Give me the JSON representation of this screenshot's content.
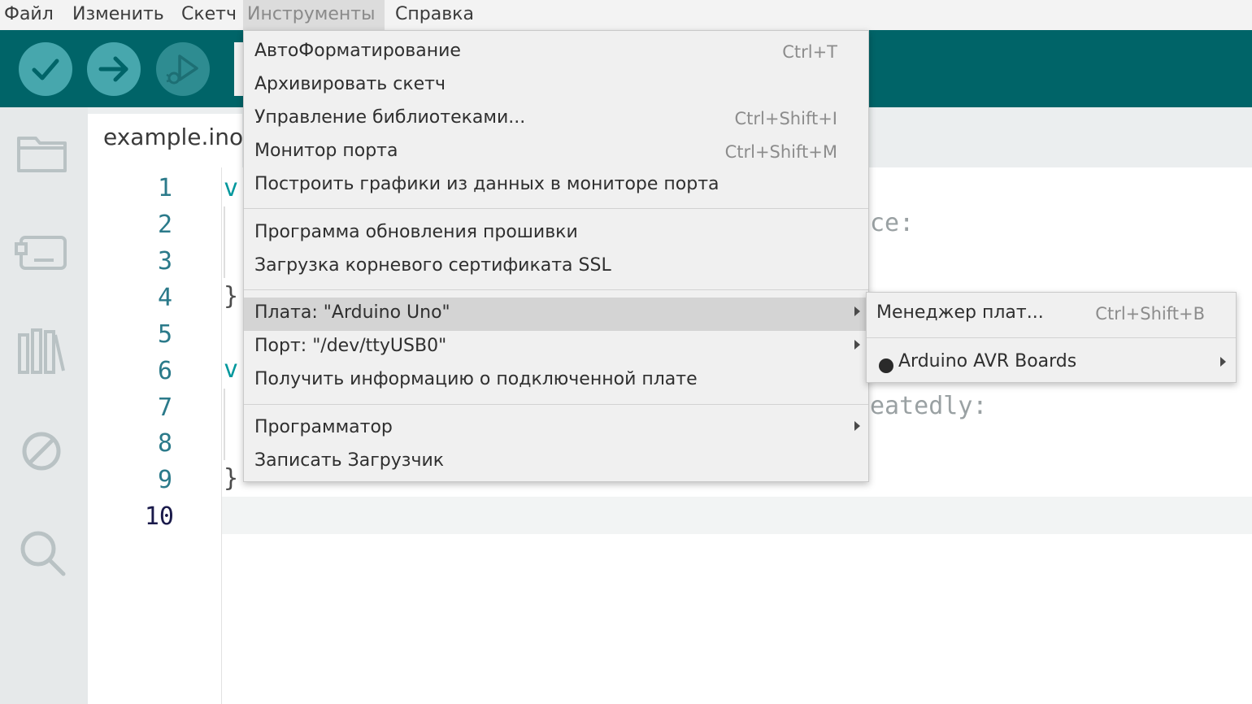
{
  "menubar": {
    "file": "Файл",
    "edit": "Изменить",
    "sketch": "Скетч",
    "tools": "Инструменты",
    "help": "Справка"
  },
  "toolbar": {
    "verify_icon": "check-icon",
    "upload_icon": "arrow-right-icon",
    "debug_icon": "debug-icon"
  },
  "sidebar": {
    "icons": [
      "folder-icon",
      "board-icon",
      "library-icon",
      "debug-off-icon",
      "search-icon"
    ]
  },
  "editor": {
    "tab_name": "example.ino",
    "line_numbers": [
      "1",
      "2",
      "3",
      "4",
      "5",
      "6",
      "7",
      "8",
      "9",
      "10"
    ],
    "current_line": "10",
    "visible_code": {
      "line1_fragment": "v",
      "line2_fragment": "ce:",
      "line4_fragment": "}",
      "line6_fragment": "v",
      "line7_fragment": "eatedly:",
      "line9_fragment": "}"
    }
  },
  "tools_menu": {
    "items": [
      {
        "label": "АвтоФорматирование",
        "shortcut": "Ctrl+T"
      },
      {
        "label": "Архивировать скетч",
        "shortcut": ""
      },
      {
        "label": "Управление библиотеками...",
        "shortcut": "Ctrl+Shift+I"
      },
      {
        "label": "Монитор порта",
        "shortcut": "Ctrl+Shift+M"
      },
      {
        "label": "Построить графики из данных в мониторе порта",
        "shortcut": ""
      },
      {
        "label": "Программа обновления прошивки",
        "shortcut": ""
      },
      {
        "label": "Загрузка корневого сертификата SSL",
        "shortcut": ""
      },
      {
        "label": "Плата: \"Arduino Uno\"",
        "shortcut": "",
        "submenu": true,
        "highlighted": true
      },
      {
        "label": "Порт: \"/dev/ttyUSB0\"",
        "shortcut": "",
        "submenu": true
      },
      {
        "label": "Получить информацию о подключенной плате",
        "shortcut": ""
      },
      {
        "label": "Программатор",
        "shortcut": "",
        "submenu": true
      },
      {
        "label": "Записать Загрузчик",
        "shortcut": ""
      }
    ]
  },
  "board_submenu": {
    "manager_label": "Менеджер плат...",
    "manager_shortcut": "Ctrl+Shift+B",
    "platform_label": "Arduino AVR Boards"
  },
  "colors": {
    "toolbar": "#006468",
    "button": "#47a7ad",
    "keyword": "#00979c"
  }
}
